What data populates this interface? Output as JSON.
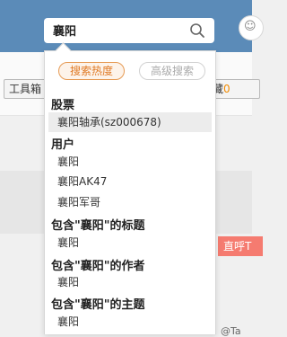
{
  "search": {
    "value": "襄阳"
  },
  "dropdown": {
    "tabs": [
      {
        "label": "搜索热度"
      },
      {
        "label": "高级搜索"
      }
    ],
    "sections": [
      {
        "title": "股票",
        "items": [
          "襄阳轴承(sz000678)"
        ]
      },
      {
        "title": "用户",
        "items": [
          "襄阳",
          "襄阳AK47",
          "襄阳军哥"
        ]
      },
      {
        "title": "包含\"襄阳\"的标题",
        "items": [
          "襄阳"
        ]
      },
      {
        "title": "包含\"襄阳\"的作者",
        "items": [
          "襄阳"
        ]
      },
      {
        "title": "包含\"襄阳\"的主题",
        "items": [
          "襄阳"
        ]
      }
    ]
  },
  "background": {
    "tool_button": "工具箱",
    "fav_label": "藏",
    "fav_count": "0",
    "live_tag": "直呼T",
    "mention": "@Ta"
  },
  "colors": {
    "topbar": "#5b8bb8",
    "accent_orange": "#e07a25",
    "live_tag": "#f57b70"
  }
}
